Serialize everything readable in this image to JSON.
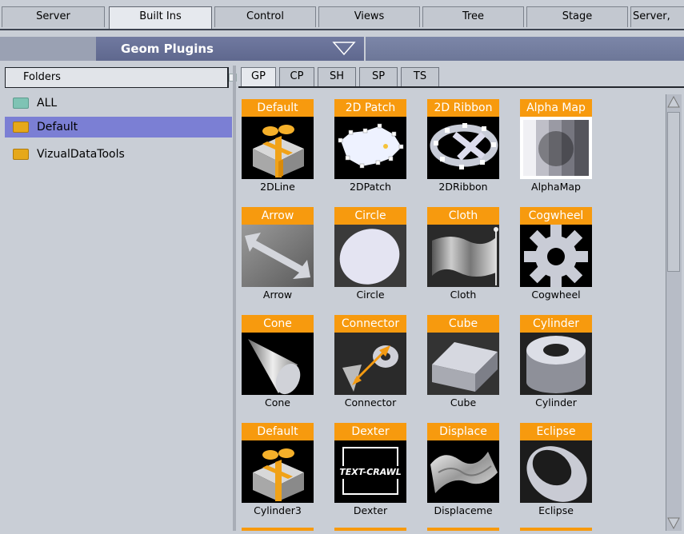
{
  "top_tabs": [
    {
      "label": "Server"
    },
    {
      "label": "Built Ins"
    },
    {
      "label": "Control"
    },
    {
      "label": "Views"
    },
    {
      "label": "Tree"
    },
    {
      "label": "Stage"
    },
    {
      "label": "Server,"
    }
  ],
  "active_top_tab": "Built Ins",
  "plugin_dropdown": {
    "selected": "Geom Plugins",
    "icon": "triangle-down-icon"
  },
  "folders": {
    "header": "Folders",
    "items": [
      {
        "label": "ALL",
        "icon": "folder-teal-icon",
        "color": "#7fc3b4",
        "selected": false
      },
      {
        "label": "Default",
        "icon": "folder-yellow-icon",
        "color": "#e6a81a",
        "selected": true
      },
      {
        "label": "VizualDataTools",
        "icon": "folder-yellow-icon",
        "color": "#e6a81a",
        "selected": false
      }
    ]
  },
  "sub_tabs": [
    {
      "label": "GP"
    },
    {
      "label": "CP"
    },
    {
      "label": "SH"
    },
    {
      "label": "SP"
    },
    {
      "label": "TS"
    }
  ],
  "active_sub_tab": "GP",
  "plugins": [
    {
      "title": "Default",
      "caption": "2DLine",
      "icon": "default-gift-icon"
    },
    {
      "title": "2D Patch",
      "caption": "2DPatch",
      "icon": "2d-patch-icon"
    },
    {
      "title": "2D Ribbon",
      "caption": "2DRibbon",
      "icon": "2d-ribbon-icon"
    },
    {
      "title": "Alpha Map",
      "caption": "AlphaMap",
      "icon": "alpha-map-icon"
    },
    {
      "title": "Arrow",
      "caption": "Arrow",
      "icon": "arrow-icon"
    },
    {
      "title": "Circle",
      "caption": "Circle",
      "icon": "circle-icon"
    },
    {
      "title": "Cloth",
      "caption": "Cloth",
      "icon": "cloth-icon"
    },
    {
      "title": "Cogwheel",
      "caption": "Cogwheel",
      "icon": "cogwheel-icon"
    },
    {
      "title": "Cone",
      "caption": "Cone",
      "icon": "cone-icon"
    },
    {
      "title": "Connector",
      "caption": "Connector",
      "icon": "connector-icon"
    },
    {
      "title": "Cube",
      "caption": "Cube",
      "icon": "cube-icon"
    },
    {
      "title": "Cylinder",
      "caption": "Cylinder",
      "icon": "cylinder-icon"
    },
    {
      "title": "Default",
      "caption": "Cylinder3",
      "icon": "default-gift-icon"
    },
    {
      "title": "Dexter",
      "caption": "Dexter",
      "icon": "dexter-icon",
      "image_text": "TEXT-CRAWL"
    },
    {
      "title": "Displace",
      "caption": "Displaceme",
      "icon": "displace-icon"
    },
    {
      "title": "Eclipse",
      "caption": "Eclipse",
      "icon": "eclipse-icon"
    }
  ],
  "colors": {
    "tile_label_bg": "#f79a0e",
    "selection": "#7b7fd4",
    "dropdown": "#6a7398"
  }
}
